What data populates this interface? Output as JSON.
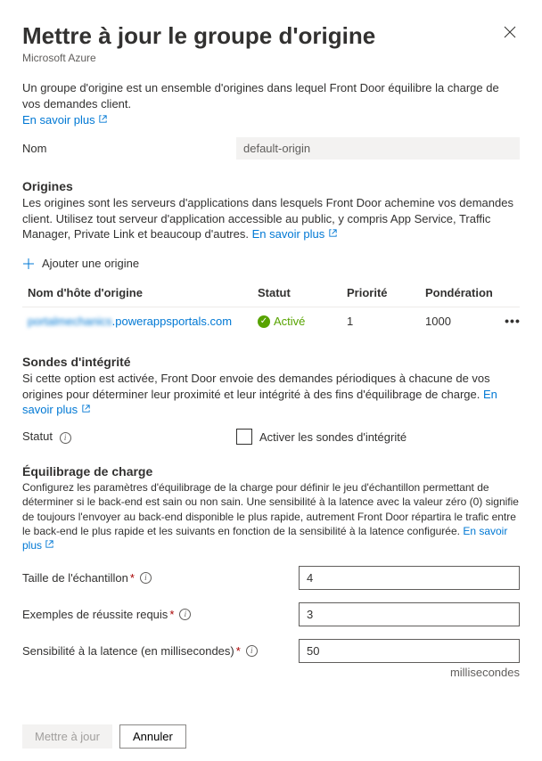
{
  "header": {
    "title": "Mettre à jour le groupe d'origine",
    "subtitle": "Microsoft Azure"
  },
  "intro": {
    "desc": "Un groupe d'origine est un ensemble d'origines dans lequel Front Door équilibre la charge de vos demandes client.",
    "link": "En savoir plus"
  },
  "name": {
    "label": "Nom",
    "value": "default-origin"
  },
  "origins": {
    "title": "Origines",
    "desc": "Les origines sont les serveurs d'applications dans lesquels Front Door achemine vos demandes client. Utilisez tout serveur d'application accessible au public, y compris App Service, Traffic Manager, Private Link et beaucoup d'autres. ",
    "link": "En savoir plus",
    "add_label": "Ajouter une origine",
    "cols": {
      "host": "Nom d'hôte d'origine",
      "status": "Statut",
      "priority": "Priorité",
      "weight": "Pondération"
    },
    "rows": [
      {
        "host_prefix": "portalmechanics",
        "host_suffix": ".powerappsportals.com",
        "status": "Activé",
        "priority": "1",
        "weight": "1000"
      }
    ]
  },
  "probes": {
    "title": "Sondes d'intégrité",
    "desc": "Si cette option est activée, Front Door envoie des demandes périodiques à chacune de vos origines pour déterminer leur proximité et leur intégrité à des fins d'équilibrage de charge. ",
    "link": "En savoir plus",
    "status_label": "Statut",
    "checkbox_label": "Activer les sondes d'intégrité"
  },
  "lb": {
    "title": "Équilibrage de charge",
    "desc": "Configurez les paramètres d'équilibrage de la charge pour définir le jeu d'échantillon permettant de déterminer si le back-end est sain ou non sain. Une sensibilité à la latence avec la valeur zéro (0) signifie de toujours l'envoyer au back-end disponible le plus rapide, autrement Front Door répartira le trafic entre le back-end le plus rapide et les suivants en fonction de la sensibilité à la latence configurée. ",
    "link": "En savoir plus",
    "fields": {
      "sample_size": {
        "label": "Taille de l'échantillon",
        "value": "4"
      },
      "success_required": {
        "label": "Exemples de réussite requis",
        "value": "3"
      },
      "latency": {
        "label": "Sensibilité à la latence (en millisecondes)",
        "value": "50",
        "unit": "millisecondes"
      }
    }
  },
  "footer": {
    "primary": "Mettre à jour",
    "secondary": "Annuler"
  }
}
